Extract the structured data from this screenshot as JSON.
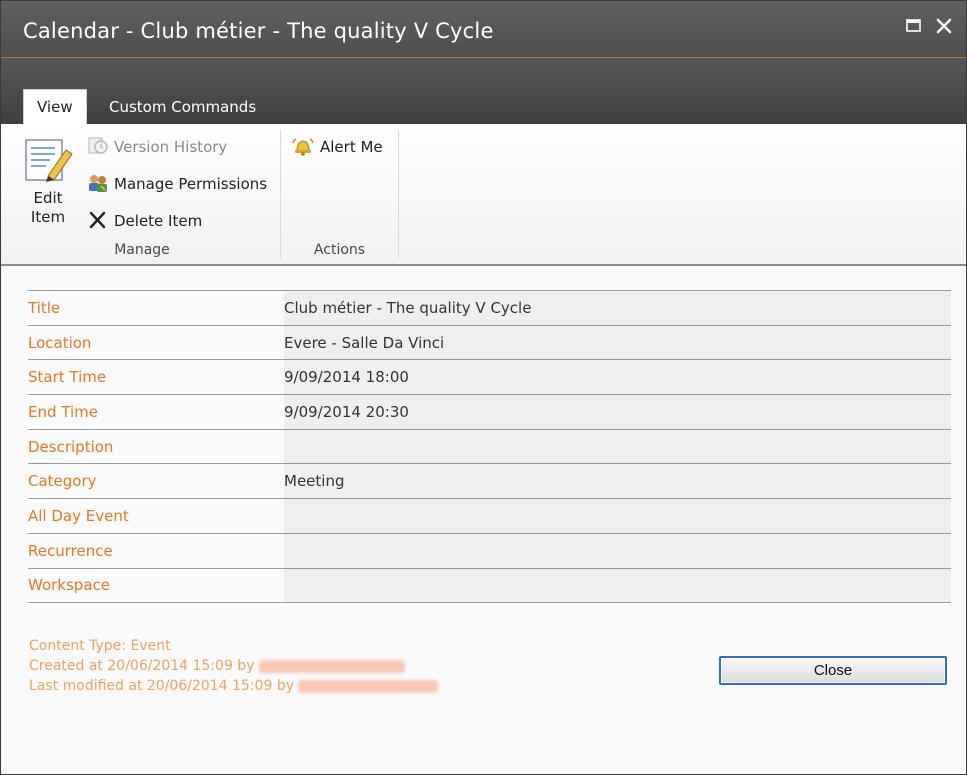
{
  "window": {
    "title": "Calendar - Club métier - The quality V Cycle",
    "maximize_icon": "maximize-icon",
    "close_icon": "close-icon"
  },
  "tabs": [
    {
      "label": "View",
      "active": true
    },
    {
      "label": "Custom Commands",
      "active": false
    }
  ],
  "ribbon": {
    "manage": {
      "group_label": "Manage",
      "edit_item_line1": "Edit",
      "edit_item_line2": "Item",
      "version_history": "Version History",
      "manage_permissions": "Manage Permissions",
      "delete_item": "Delete Item"
    },
    "actions": {
      "group_label": "Actions",
      "alert_me": "Alert Me"
    }
  },
  "fields": [
    {
      "label": "Title",
      "value": "Club métier - The quality V Cycle"
    },
    {
      "label": "Location",
      "value": "Evere - Salle  Da Vinci"
    },
    {
      "label": "Start Time",
      "value": "9/09/2014 18:00"
    },
    {
      "label": "End Time",
      "value": "9/09/2014 20:30"
    },
    {
      "label": "Description",
      "value": ""
    },
    {
      "label": "Category",
      "value": "Meeting"
    },
    {
      "label": "All Day Event",
      "value": ""
    },
    {
      "label": "Recurrence",
      "value": ""
    },
    {
      "label": "Workspace",
      "value": ""
    }
  ],
  "footer": {
    "content_type": "Content Type: Event",
    "created": "Created at 20/06/2014 15:09 by",
    "modified": "Last modified at 20/06/2014 15:09 by",
    "close_label": "Close"
  },
  "colors": {
    "label_orange": "#e87722",
    "meta_orange": "#f0a060",
    "title_bar": "#555555",
    "button_focus_border": "#2f6ec2"
  }
}
